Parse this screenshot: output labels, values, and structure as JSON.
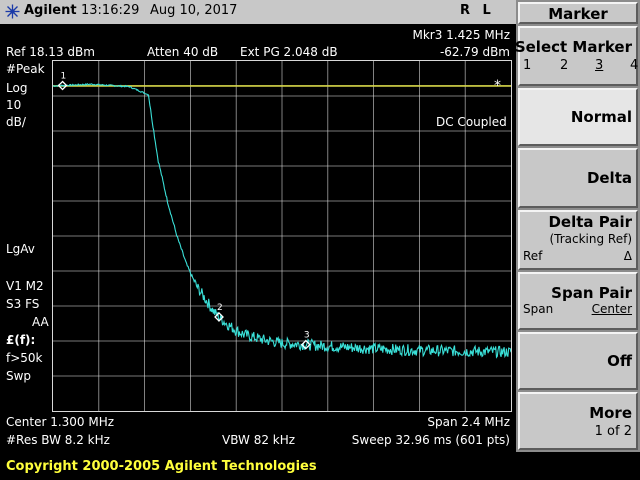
{
  "header": {
    "brand": "Agilent",
    "time": "13:16:29",
    "date": "Aug 10, 2017",
    "status": "R L"
  },
  "marker_readout": {
    "line1": "Mkr3  1.425 MHz",
    "line2": "-62.79 dBm"
  },
  "settings": {
    "ref": "Ref 18.13 dBm",
    "atten": "Atten 40 dB",
    "ext_pg": "Ext PG 2.048 dB"
  },
  "left_annotations": {
    "peak": "#Peak",
    "log": "Log",
    "scale": "10",
    "unit": "dB/",
    "lgav": "LgAv",
    "v1m2": "V1  M2",
    "s3fs": "S3  FS",
    "aa": "AA",
    "ff": "£(f):",
    "f50k": "f>50k",
    "swp": "Swp"
  },
  "graticule_notes": {
    "asterisk": "*",
    "coupling": "DC Coupled"
  },
  "bottom": {
    "center": "Center 1.300 MHz",
    "span": "Span 2.4 MHz",
    "res_bw": "#Res BW 8.2 kHz",
    "vbw": "VBW 82 kHz",
    "sweep": "Sweep 32.96 ms (601 pts)"
  },
  "softkeys": {
    "menu_title": "Marker",
    "select_marker": {
      "label": "Select Marker",
      "options": [
        "1",
        "2",
        "3",
        "4"
      ],
      "selected": "3"
    },
    "normal": "Normal",
    "delta": "Delta",
    "delta_pair": {
      "label": "Delta Pair",
      "sub": "(Tracking Ref)",
      "left": "Ref",
      "right": "Δ"
    },
    "span_pair": {
      "label": "Span Pair",
      "left": "Span",
      "right": "Center"
    },
    "off": "Off",
    "more": {
      "label": "More",
      "sub": "1 of 2"
    }
  },
  "copyright": "Copyright 2000-2005 Agilent Technologies",
  "markers": [
    {
      "label": "1",
      "freq_mhz": 0.15
    },
    {
      "label": "2",
      "freq_mhz": 0.97
    },
    {
      "label": "3",
      "freq_mhz": 1.425
    }
  ],
  "chart_data": {
    "type": "line",
    "x_start_mhz": 0.1,
    "x_stop_mhz": 2.5,
    "ref_level_dbm": 18.13,
    "db_per_div": 10,
    "divisions": 10,
    "grid": true,
    "colors": {
      "trace": "#3ae0d8",
      "display_line": "#d8d84a",
      "grid": "#d8d8d8",
      "marker": "#ffffff"
    },
    "display_line_dbm": 11.0,
    "series": [
      {
        "x": [
          0.1,
          0.3,
          0.5,
          0.6,
          0.62,
          0.65,
          0.7,
          0.75,
          0.8,
          0.85,
          0.9,
          0.95,
          1.0,
          1.05,
          1.1,
          1.2,
          1.3,
          1.4,
          1.5,
          1.75,
          2.0,
          2.25,
          2.5
        ],
        "y": [
          11.0,
          11.5,
          10.8,
          8.5,
          1.0,
          -10.0,
          -22.0,
          -32.0,
          -40.0,
          -46.0,
          -50.0,
          -54.0,
          -56.5,
          -58.5,
          -60.0,
          -61.5,
          -62.5,
          -62.8,
          -63.2,
          -64.0,
          -64.5,
          -64.8,
          -65.0
        ]
      }
    ]
  }
}
